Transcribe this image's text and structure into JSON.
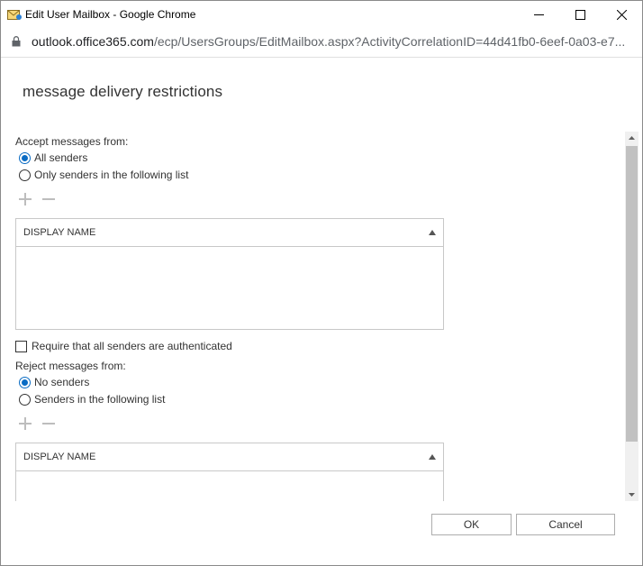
{
  "window": {
    "title": "Edit User Mailbox - Google Chrome",
    "url_host": "outlook.office365.com",
    "url_path": "/ecp/UsersGroups/EditMailbox.aspx?ActivityCorrelationID=44d41fb0-6eef-0a03-e7..."
  },
  "page": {
    "title": "message delivery restrictions"
  },
  "accept": {
    "label": "Accept messages from:",
    "options": [
      {
        "label": "All senders",
        "checked": true
      },
      {
        "label": "Only senders in the following list",
        "checked": false
      }
    ],
    "column_header": "DISPLAY NAME"
  },
  "require_auth": {
    "label": "Require that all senders are authenticated",
    "checked": false
  },
  "reject": {
    "label": "Reject messages from:",
    "options": [
      {
        "label": "No senders",
        "checked": true
      },
      {
        "label": "Senders in the following list",
        "checked": false
      }
    ],
    "column_header": "DISPLAY NAME"
  },
  "buttons": {
    "ok": "OK",
    "cancel": "Cancel"
  },
  "colors": {
    "accent": "#0a6cc4",
    "border": "#c8c8c8",
    "scroll_thumb": "#c1c1c1"
  }
}
